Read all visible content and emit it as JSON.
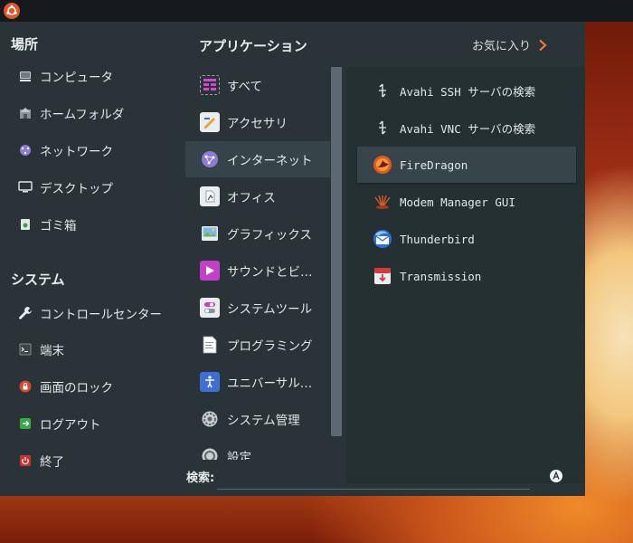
{
  "places": {
    "title": "場所",
    "items": [
      {
        "label": "コンピュータ",
        "icon": "computer-icon"
      },
      {
        "label": "ホームフォルダ",
        "icon": "home-folder-icon"
      },
      {
        "label": "ネットワーク",
        "icon": "network-icon"
      },
      {
        "label": "デスクトップ",
        "icon": "desktop-icon"
      },
      {
        "label": "ゴミ箱",
        "icon": "trash-icon"
      }
    ]
  },
  "system": {
    "title": "システム",
    "items": [
      {
        "label": "コントロールセンター",
        "icon": "wrench-icon"
      },
      {
        "label": "端末",
        "icon": "terminal-icon"
      },
      {
        "label": "画面のロック",
        "icon": "lock-icon"
      },
      {
        "label": "ログアウト",
        "icon": "logout-icon"
      },
      {
        "label": "終了",
        "icon": "power-icon"
      }
    ]
  },
  "applications": {
    "title": "アプリケーション",
    "favorites_label": "お気に入り",
    "categories": [
      {
        "label": "すべて",
        "icon": "all-apps-icon"
      },
      {
        "label": "アクセサリ",
        "icon": "accessories-icon"
      },
      {
        "label": "インターネット",
        "icon": "internet-icon"
      },
      {
        "label": "オフィス",
        "icon": "office-icon"
      },
      {
        "label": "グラフィックス",
        "icon": "graphics-icon"
      },
      {
        "label": "サウンドとビ…",
        "icon": "sound-video-icon"
      },
      {
        "label": "システムツール",
        "icon": "system-tools-icon"
      },
      {
        "label": "プログラミング",
        "icon": "programming-icon"
      },
      {
        "label": "ユニバーサル…",
        "icon": "universal-access-icon"
      },
      {
        "label": "システム管理",
        "icon": "system-admin-icon"
      },
      {
        "label": "設定",
        "icon": "settings-icon"
      }
    ],
    "selected_category": "インターネット",
    "apps": [
      {
        "label": "Avahi SSH サーバの検索",
        "icon": "avahi-ssh-icon"
      },
      {
        "label": "Avahi VNC サーバの検索",
        "icon": "avahi-vnc-icon"
      },
      {
        "label": "FireDragon",
        "icon": "firedragon-icon"
      },
      {
        "label": "Modem Manager GUI",
        "icon": "modem-manager-icon"
      },
      {
        "label": "Thunderbird",
        "icon": "thunderbird-icon"
      },
      {
        "label": "Transmission",
        "icon": "transmission-icon"
      }
    ],
    "selected_app": "FireDragon"
  },
  "search": {
    "label": "検索:",
    "value": ""
  },
  "colors": {
    "menu_bg": "#2a3438",
    "selection": "#36444a",
    "accent": "#e0572a"
  }
}
